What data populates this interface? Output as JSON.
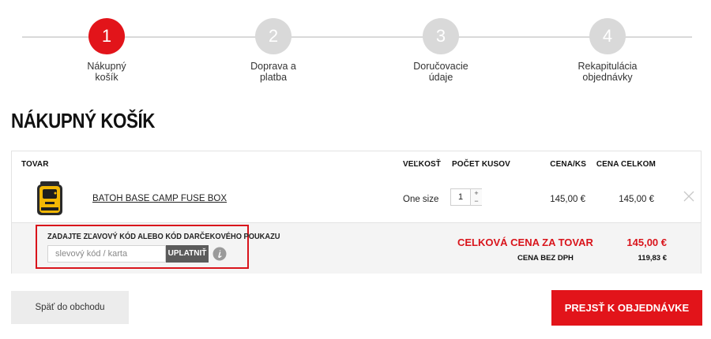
{
  "stepper": {
    "steps": [
      {
        "number": "1",
        "label": "Nákupný\nkošík",
        "active": true
      },
      {
        "number": "2",
        "label": "Doprava a\nplatba",
        "active": false
      },
      {
        "number": "3",
        "label": "Doručovacie\núdaje",
        "active": false
      },
      {
        "number": "4",
        "label": "Rekapitulácia\nobjednávky",
        "active": false
      }
    ]
  },
  "page_title": "NÁKUPNÝ KOŠÍK",
  "cart": {
    "headers": {
      "product": "TOVAR",
      "size": "VEĽKOSŤ",
      "quantity": "POČET KUSOV",
      "unit_price": "CENA/KS",
      "total": "CENA CELKOM"
    },
    "items": [
      {
        "name": "BATOH BASE CAMP FUSE BOX",
        "size": "One size",
        "quantity": "1",
        "unit_price": "145,00 €",
        "total": "145,00 €"
      }
    ],
    "voucher": {
      "label": "ZADAJTE ZĽAVOVÝ KÓD ALEBO KÓD DARČEKOVÉHO POUKAZU",
      "placeholder": "slevový kód / karta",
      "apply_label": "UPLATNIŤ"
    },
    "summary": {
      "total_label": "CELKOVÁ CENA ZA TOVAR",
      "total_value": "145,00 €",
      "net_label": "CENA BEZ DPH",
      "net_value": "119,83 €"
    }
  },
  "actions": {
    "back_label": "Späť do obchodu",
    "checkout_label": "PREJSŤ K OBJEDNÁVKE"
  },
  "colors": {
    "accent": "#e2141a",
    "inactive_step": "#d9d9d9",
    "footer_bg": "#f4f4f4"
  },
  "icons": {
    "plus": "+",
    "minus": "−",
    "remove": "close-icon",
    "info": "info-icon"
  }
}
